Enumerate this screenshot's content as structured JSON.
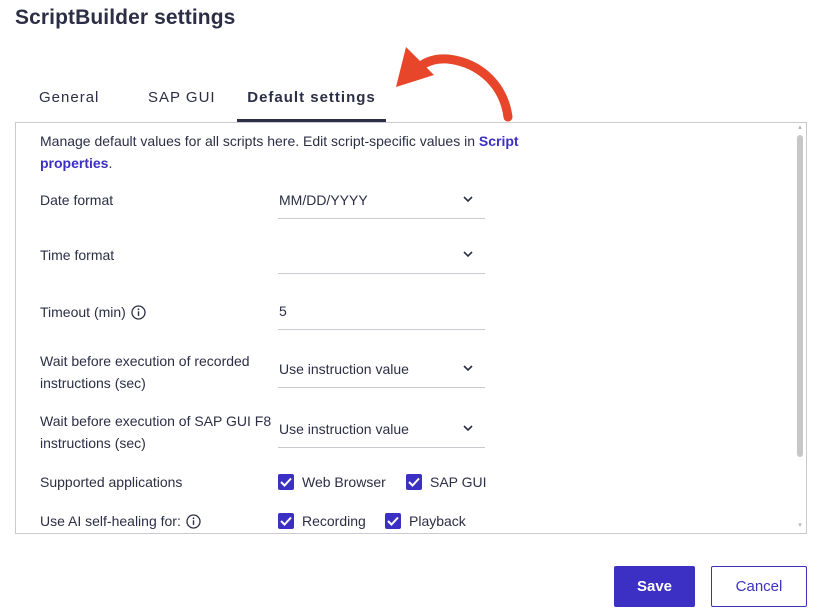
{
  "dialog": {
    "title": "ScriptBuilder settings"
  },
  "tabs": [
    {
      "label": "General"
    },
    {
      "label": "SAP GUI"
    },
    {
      "label": "Default settings",
      "active": true
    }
  ],
  "intro": {
    "text_before": "Manage default values for all scripts here. Edit script-specific values in ",
    "link": "Script properties",
    "text_after": "."
  },
  "fields": {
    "date_format": {
      "label": "Date format",
      "value": "MM/DD/YYYY"
    },
    "time_format": {
      "label": "Time format",
      "value": ""
    },
    "timeout": {
      "label": "Timeout (min)",
      "value": "5"
    },
    "wait_recorded": {
      "label": "Wait before execution of recorded instructions (sec)",
      "value": "Use instruction value"
    },
    "wait_sapgui": {
      "label": "Wait before execution of SAP GUI F8 instructions (sec)",
      "value": "Use instruction value"
    }
  },
  "supported_apps": {
    "label": "Supported applications",
    "options": [
      {
        "label": "Web Browser",
        "checked": true
      },
      {
        "label": "SAP GUI",
        "checked": true
      }
    ]
  },
  "ai_self_healing": {
    "label": "Use AI self-healing for:",
    "options": [
      {
        "label": "Recording",
        "checked": true
      },
      {
        "label": "Playback",
        "checked": true
      }
    ]
  },
  "buttons": {
    "save": "Save",
    "cancel": "Cancel"
  },
  "colors": {
    "accent": "#3b2fc4",
    "arrow": "#e8462a",
    "text": "#2c2e45"
  }
}
